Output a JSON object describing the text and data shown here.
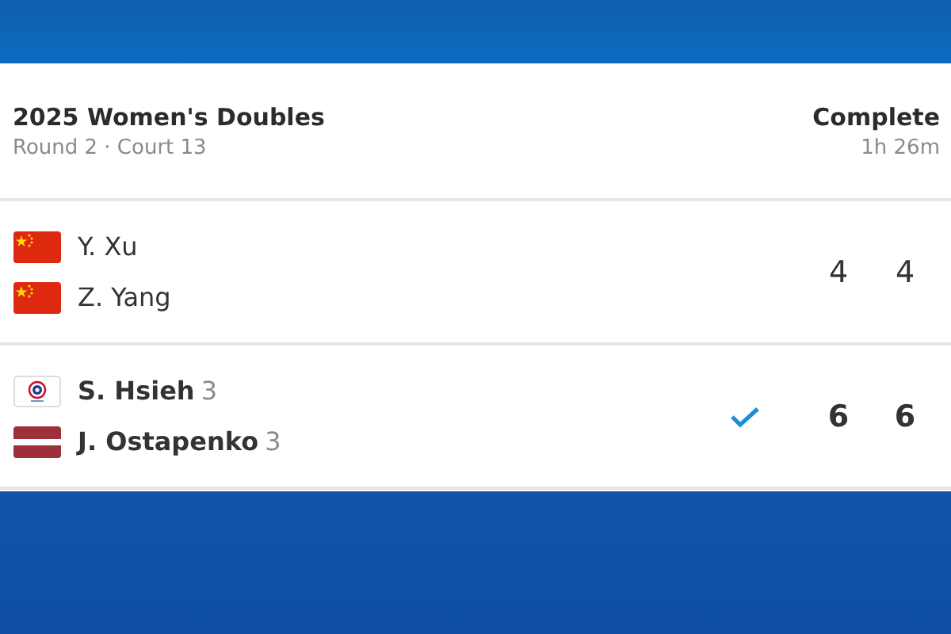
{
  "match": {
    "title": "2025 Women's Doubles",
    "subtitle": "Round 2 · Court 13",
    "status": "Complete",
    "duration": "1h 26m"
  },
  "teams": [
    {
      "winner": false,
      "players": [
        {
          "name": "Y. Xu",
          "kind": "china"
        },
        {
          "name": "Z. Yang",
          "kind": "china"
        }
      ],
      "scores": [
        "4",
        "4"
      ]
    },
    {
      "winner": true,
      "players": [
        {
          "name": "S. Hsieh",
          "seed": "3",
          "kind": "taipei"
        },
        {
          "name": "J. Ostapenko",
          "seed": "3",
          "kind": "latvia"
        }
      ],
      "scores": [
        "6",
        "6"
      ]
    }
  ]
}
